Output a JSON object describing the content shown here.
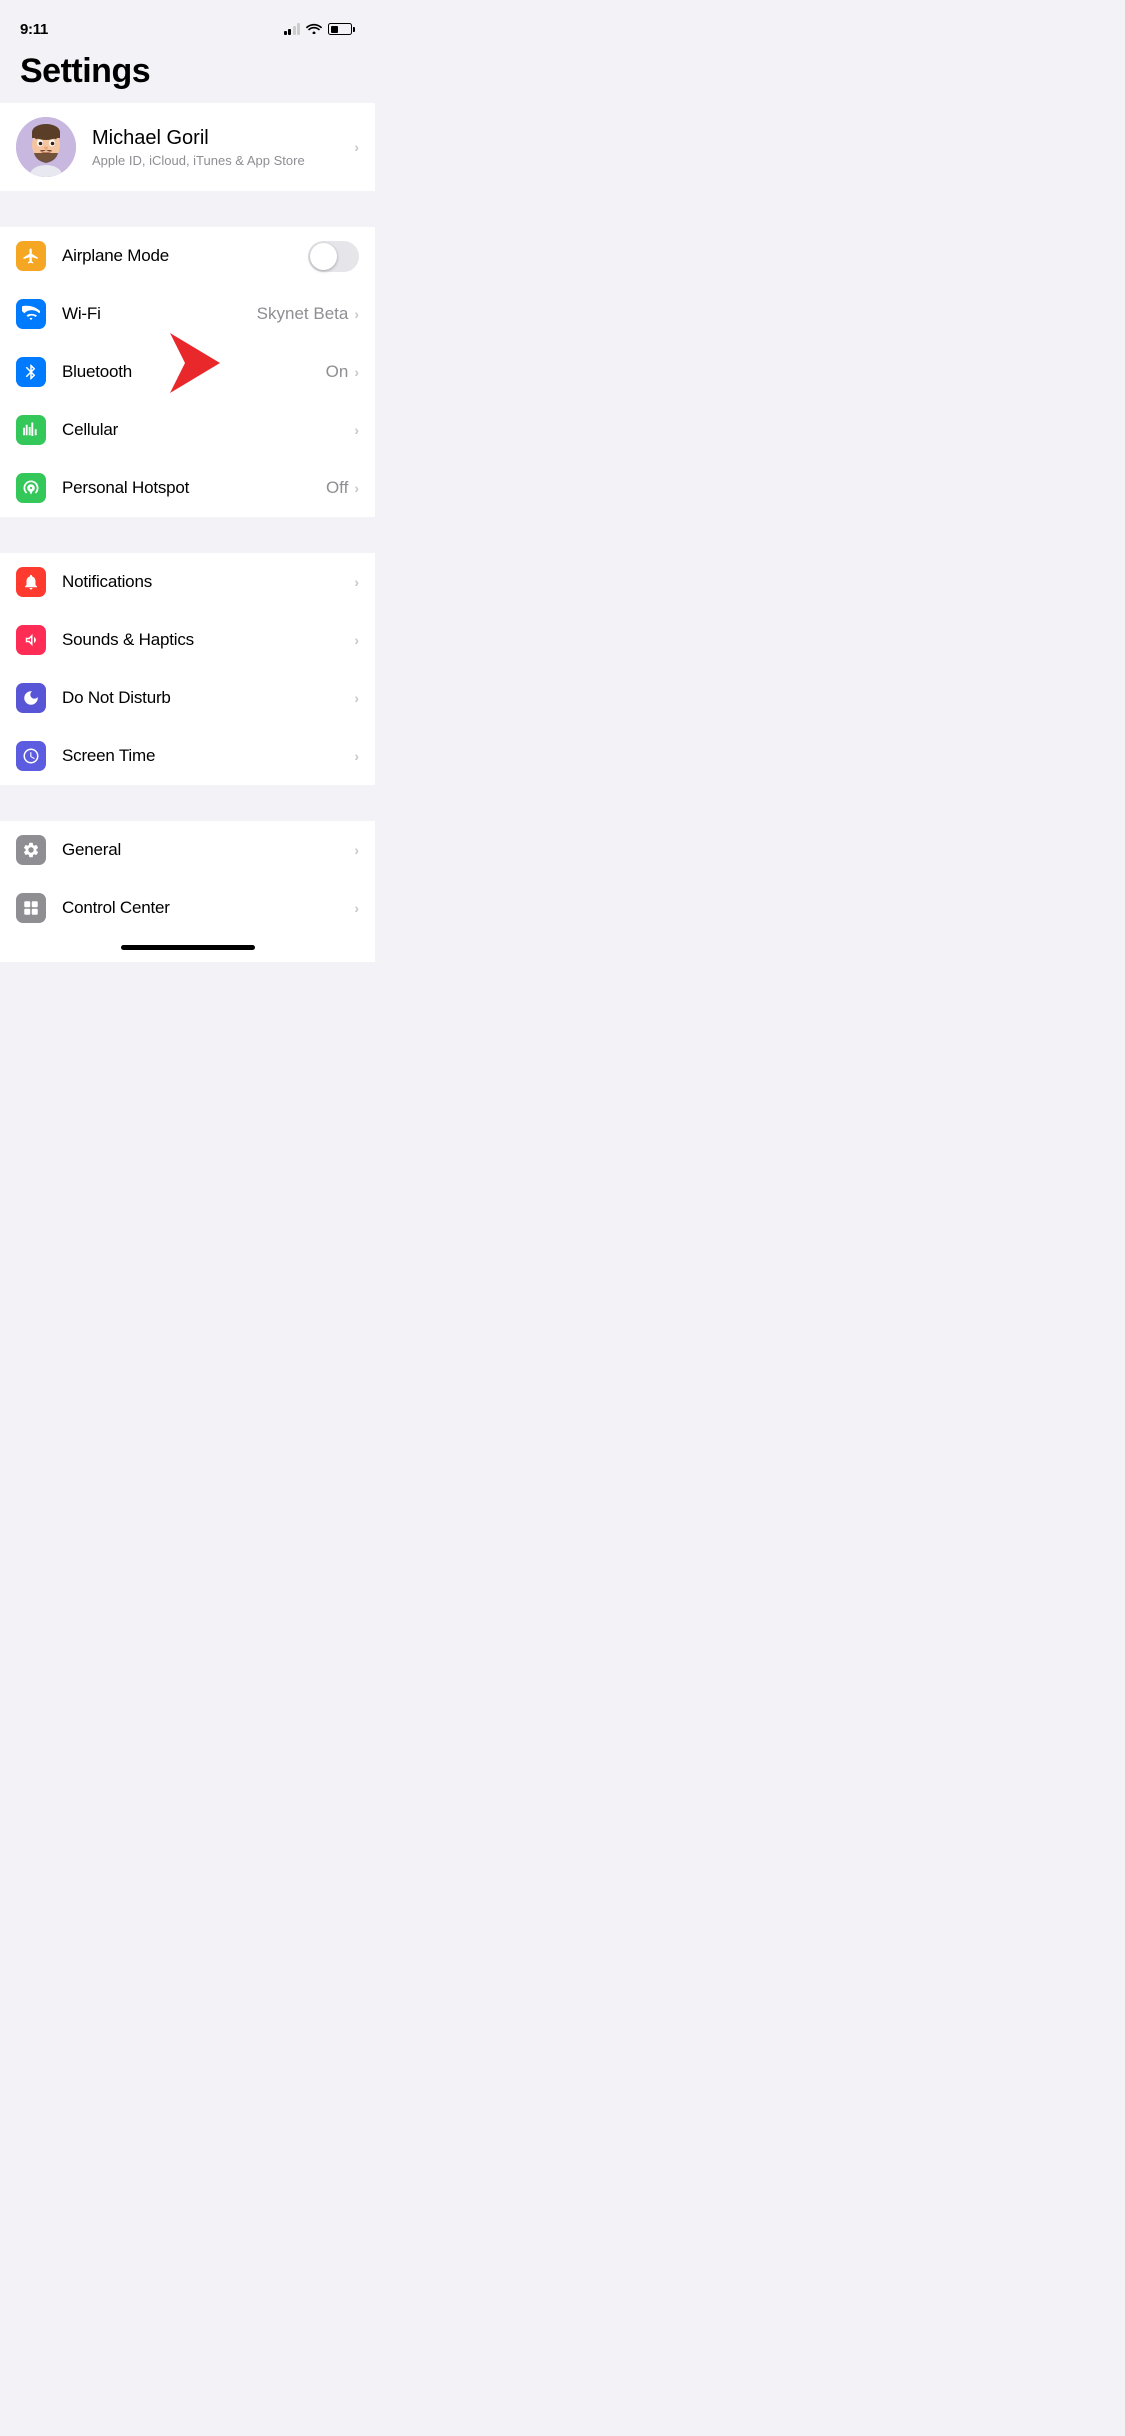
{
  "statusBar": {
    "time": "9:11",
    "hasLocation": true
  },
  "pageTitle": "Settings",
  "profile": {
    "name": "Michael Goril",
    "subtitle": "Apple ID, iCloud, iTunes & App Store"
  },
  "groups": [
    {
      "id": "connectivity",
      "items": [
        {
          "id": "airplane-mode",
          "label": "Airplane Mode",
          "icon": "airplane",
          "iconColor": "orange",
          "hasToggle": true,
          "toggleOn": false
        },
        {
          "id": "wifi",
          "label": "Wi-Fi",
          "icon": "wifi",
          "iconColor": "blue",
          "value": "Skynet Beta",
          "hasChevron": true
        },
        {
          "id": "bluetooth",
          "label": "Bluetooth",
          "icon": "bluetooth",
          "iconColor": "bluetooth",
          "value": "On",
          "hasChevron": true,
          "hasArrow": true
        },
        {
          "id": "cellular",
          "label": "Cellular",
          "icon": "cellular",
          "iconColor": "green-dark",
          "hasChevron": true
        },
        {
          "id": "personal-hotspot",
          "label": "Personal Hotspot",
          "icon": "hotspot",
          "iconColor": "green-link",
          "value": "Off",
          "hasChevron": true
        }
      ]
    },
    {
      "id": "notifications",
      "items": [
        {
          "id": "notifications",
          "label": "Notifications",
          "icon": "notifications",
          "iconColor": "red",
          "hasChevron": true
        },
        {
          "id": "sounds-haptics",
          "label": "Sounds & Haptics",
          "icon": "sounds",
          "iconColor": "pink",
          "hasChevron": true
        },
        {
          "id": "do-not-disturb",
          "label": "Do Not Disturb",
          "icon": "moon",
          "iconColor": "purple",
          "hasChevron": true
        },
        {
          "id": "screen-time",
          "label": "Screen Time",
          "icon": "screentime",
          "iconColor": "indigo",
          "hasChevron": true
        }
      ]
    },
    {
      "id": "general",
      "items": [
        {
          "id": "general",
          "label": "General",
          "icon": "gear",
          "iconColor": "gray",
          "hasChevron": true
        },
        {
          "id": "control-center",
          "label": "Control Center",
          "icon": "controlcenter",
          "iconColor": "gray",
          "hasChevron": true
        }
      ]
    }
  ]
}
